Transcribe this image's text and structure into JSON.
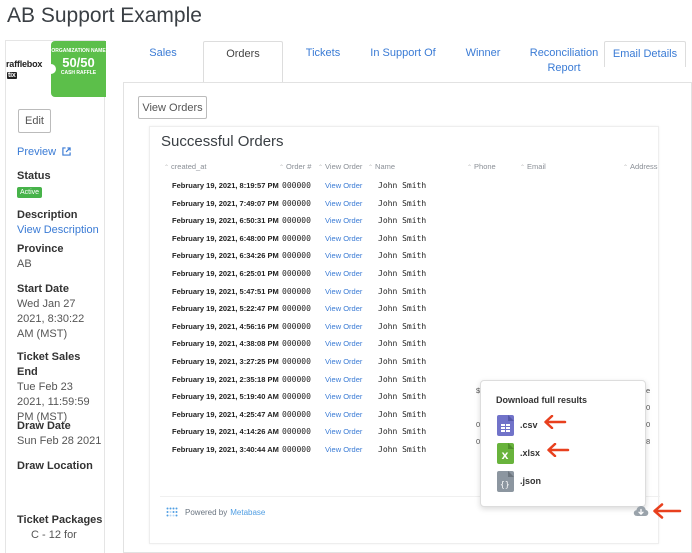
{
  "page_title": "AB Support Example",
  "logo": {
    "brand": "rafflebox",
    "brand_suffix": "tix",
    "ticket_line1": "ORGANIZATION NAME",
    "ticket_line2": "50/50",
    "ticket_line3": "CASH RAFFLE",
    "accent_color": "#5cbf4a"
  },
  "sidebar": {
    "edit_label": "Edit",
    "preview_label": "Preview",
    "status_label": "Status",
    "status_value": "Active",
    "description_label": "Description",
    "description_link": "View Description",
    "province_label": "Province",
    "province_value": "AB",
    "start_date_label": "Start Date",
    "start_date_value": "Wed Jan 27 2021, 8:30:22 AM (MST)",
    "ticket_sales_end_label": "Ticket Sales End",
    "ticket_sales_end_value": "Tue Feb 23 2021, 11:59:59 PM (MST)",
    "draw_date_label": "Draw Date",
    "draw_date_value": "Sun Feb 28 2021",
    "draw_location_label": "Draw Location",
    "ticket_packages_label": "Ticket Packages",
    "ticket_packages_value": "C - 12 for"
  },
  "tabs": [
    {
      "label": "Sales"
    },
    {
      "label": "Orders"
    },
    {
      "label": "Tickets"
    },
    {
      "label": "In Support Of"
    },
    {
      "label": "Winner"
    },
    {
      "label": "Reconciliation Report"
    },
    {
      "label": "Email Details"
    }
  ],
  "view_orders_button": "View Orders",
  "orders": {
    "title": "Successful Orders",
    "columns": [
      "created_at",
      "Order #",
      "View Order",
      "Name",
      "Phone",
      "Email",
      "Address"
    ],
    "rows": [
      {
        "created_at": "February 19, 2021, 8:19:57 PM",
        "order": "000000",
        "view": "View Order",
        "name": "John Smith"
      },
      {
        "created_at": "February 19, 2021, 7:49:07 PM",
        "order": "000000",
        "view": "View Order",
        "name": "John Smith"
      },
      {
        "created_at": "February 19, 2021, 6:50:31 PM",
        "order": "000000",
        "view": "View Order",
        "name": "John Smith"
      },
      {
        "created_at": "February 19, 2021, 6:48:00 PM",
        "order": "000000",
        "view": "View Order",
        "name": "John Smith"
      },
      {
        "created_at": "February 19, 2021, 6:34:26 PM",
        "order": "000000",
        "view": "View Order",
        "name": "John Smith"
      },
      {
        "created_at": "February 19, 2021, 6:25:01 PM",
        "order": "000000",
        "view": "View Order",
        "name": "John Smith"
      },
      {
        "created_at": "February 19, 2021, 5:47:51 PM",
        "order": "000000",
        "view": "View Order",
        "name": "John Smith"
      },
      {
        "created_at": "February 19, 2021, 5:22:47 PM",
        "order": "000000",
        "view": "View Order",
        "name": "John Smith"
      },
      {
        "created_at": "February 19, 2021, 4:56:16 PM",
        "order": "000000",
        "view": "View Order",
        "name": "John Smith"
      },
      {
        "created_at": "February 19, 2021, 4:38:08 PM",
        "order": "000000",
        "view": "View Order",
        "name": "John Smith"
      },
      {
        "created_at": "February 19, 2021, 3:27:25 PM",
        "order": "000000",
        "view": "View Order",
        "name": "John Smith"
      },
      {
        "created_at": "February 19, 2021, 2:35:18 PM",
        "order": "000000",
        "view": "View Order",
        "name": "John Smith"
      },
      {
        "created_at": "February 19, 2021, 5:19:40 AM",
        "order": "000000",
        "view": "View Order",
        "name": "John Smith"
      },
      {
        "created_at": "February 19, 2021, 4:25:47 AM",
        "order": "000000",
        "view": "View Order",
        "name": "John Smith"
      },
      {
        "created_at": "February 19, 2021, 4:14:26 AM",
        "order": "000000",
        "view": "View Order",
        "name": "John Smith"
      },
      {
        "created_at": "February 19, 2021, 3:40:44 AM",
        "order": "000000",
        "view": "View Order",
        "name": "John Smith"
      }
    ]
  },
  "powered_by": {
    "prefix": "Powered by",
    "brand": "Metabase"
  },
  "download": {
    "title": "Download full results",
    "options": [
      {
        "label": ".csv",
        "icon": "csv-file-icon",
        "color": "#7173c9"
      },
      {
        "label": ".xlsx",
        "icon": "xlsx-file-icon",
        "color": "#68b33c"
      },
      {
        "label": ".json",
        "icon": "json-file-icon",
        "color": "#8c96a0"
      }
    ]
  },
  "annotation_color": "#e8401e"
}
